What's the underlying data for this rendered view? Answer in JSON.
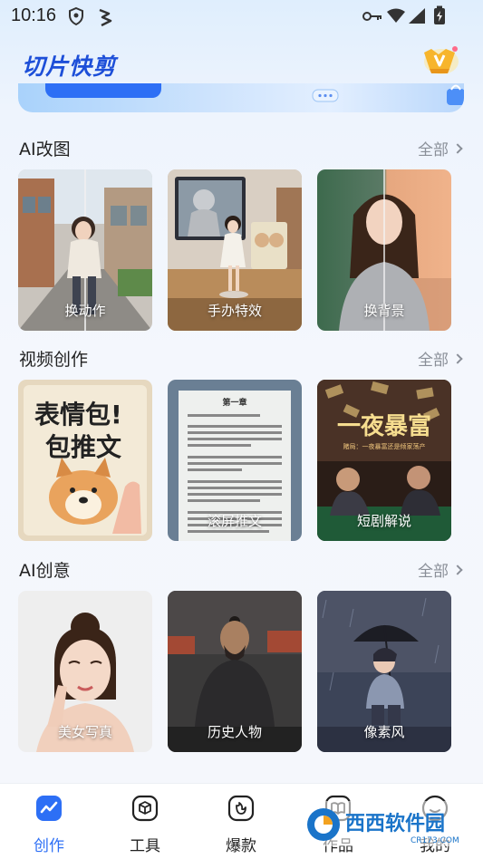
{
  "status_bar": {
    "time": "10:16",
    "icons": [
      "shield-icon",
      "lightning-icon",
      "key-icon",
      "wifi-icon",
      "signal-icon",
      "battery-charging-icon"
    ]
  },
  "header": {
    "title": "切片快剪",
    "vip_icon": "vip-crown-icon"
  },
  "sections": [
    {
      "title": "AI改图",
      "more": "全部",
      "cards": [
        {
          "label": "换动作",
          "art": "street-girl"
        },
        {
          "label": "手办特效",
          "art": "figure-desk"
        },
        {
          "label": "换背景",
          "art": "woman-sunset"
        }
      ]
    },
    {
      "title": "视频创作",
      "more": "全部",
      "cards": [
        {
          "label": "表情包推文",
          "art": "meme-dog",
          "overlay": "表情包!\n包推文"
        },
        {
          "label": "滚屏推文",
          "art": "scroll-text",
          "overlay_heading": "第一章"
        },
        {
          "label": "短剧解说",
          "art": "drama",
          "overlay": "一夜暴富",
          "overlay_sub": "赌局：一夜暴富还是倾家荡产"
        }
      ]
    },
    {
      "title": "AI创意",
      "more": "全部",
      "cards": [
        {
          "label": "美女写真",
          "art": "portrait"
        },
        {
          "label": "历史人物",
          "art": "warrior"
        },
        {
          "label": "像素风",
          "art": "pixel-rain"
        }
      ]
    }
  ],
  "bottom_nav": [
    {
      "label": "创作",
      "icon": "trend-icon",
      "active": true
    },
    {
      "label": "工具",
      "icon": "cube-icon",
      "active": false
    },
    {
      "label": "爆款",
      "icon": "fire-icon",
      "active": false
    },
    {
      "label": "作品",
      "icon": "book-icon",
      "active": false
    },
    {
      "label": "我的",
      "icon": "smile-icon",
      "active": false
    }
  ],
  "watermark": {
    "text": "西西软件园",
    "sub": "CR173.COM"
  },
  "colors": {
    "accent": "#2d6ff5",
    "title_blue": "#1d4fd8",
    "muted": "#8a8f98"
  }
}
